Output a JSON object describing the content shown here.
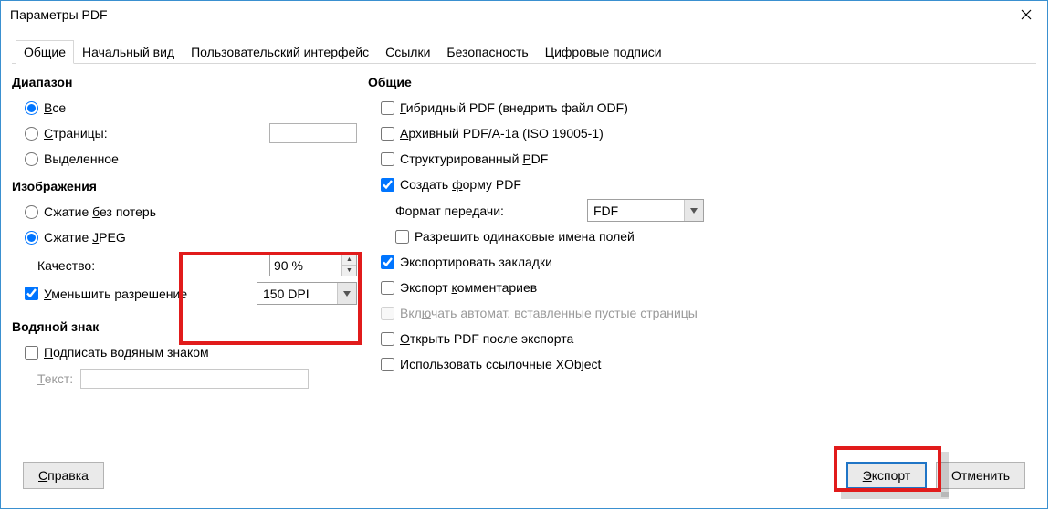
{
  "window": {
    "title": "Параметры PDF"
  },
  "tabs": {
    "general": "Общие",
    "initial": "Начальный вид",
    "ui": "Пользовательский интерфейс",
    "links": "Ссылки",
    "security": "Безопасность",
    "signatures": "Цифровые подписи"
  },
  "range": {
    "title": "Диапазон",
    "all_pre": "В",
    "all_post": "се",
    "pages_pre": "С",
    "pages_post": "траницы:",
    "pages_value": "",
    "selection": "Выделенное"
  },
  "images": {
    "title": "Изображения",
    "lossless_pre": "Сжатие ",
    "lossless_mid": "б",
    "lossless_post": "ез потерь",
    "jpeg_pre": "Сжатие ",
    "jpeg_mid": "J",
    "jpeg_post": "PEG",
    "quality_label": "Качество:",
    "quality_value": "90 %",
    "reduce_pre": "У",
    "reduce_post": "меньшить разрешение",
    "dpi_value": "150 DPI"
  },
  "watermark": {
    "title": "Водяной знак",
    "sign_pre": "П",
    "sign_post": "одписать водяным знаком",
    "text_label_pre": "Т",
    "text_label_post": "екст:",
    "text_value": ""
  },
  "general": {
    "title": "Общие",
    "hybrid_pre": "Г",
    "hybrid_post": "ибридный PDF (внедрить файл ODF)",
    "archive_pre": "А",
    "archive_post": "рхивный PDF/A-1a (ISO 19005-1)",
    "tagged_pre": "Структурированный ",
    "tagged_mid": "P",
    "tagged_post": "DF",
    "createform_pre": "Создать ",
    "createform_mid": "ф",
    "createform_post": "орму PDF",
    "submit_label": "Формат передачи:",
    "submit_value": "FDF",
    "dupnames": "Разрешить одинаковые имена полей",
    "bookmarks": "Экспортировать закладки",
    "comments_pre": "Экспорт ",
    "comments_mid": "к",
    "comments_post": "омментариев",
    "blankpages_pre": "Вкл",
    "blankpages_mid": "ю",
    "blankpages_post": "чать автомат. вставленные пустые страницы",
    "openafter_pre": "О",
    "openafter_post": "ткрыть PDF после экспорта",
    "xobject_pre": "И",
    "xobject_post": "спользовать ссылочные XObject"
  },
  "buttons": {
    "help_pre": "С",
    "help_post": "правка",
    "export_pre": "Э",
    "export_post": "кспорт",
    "cancel": "Отменить"
  }
}
